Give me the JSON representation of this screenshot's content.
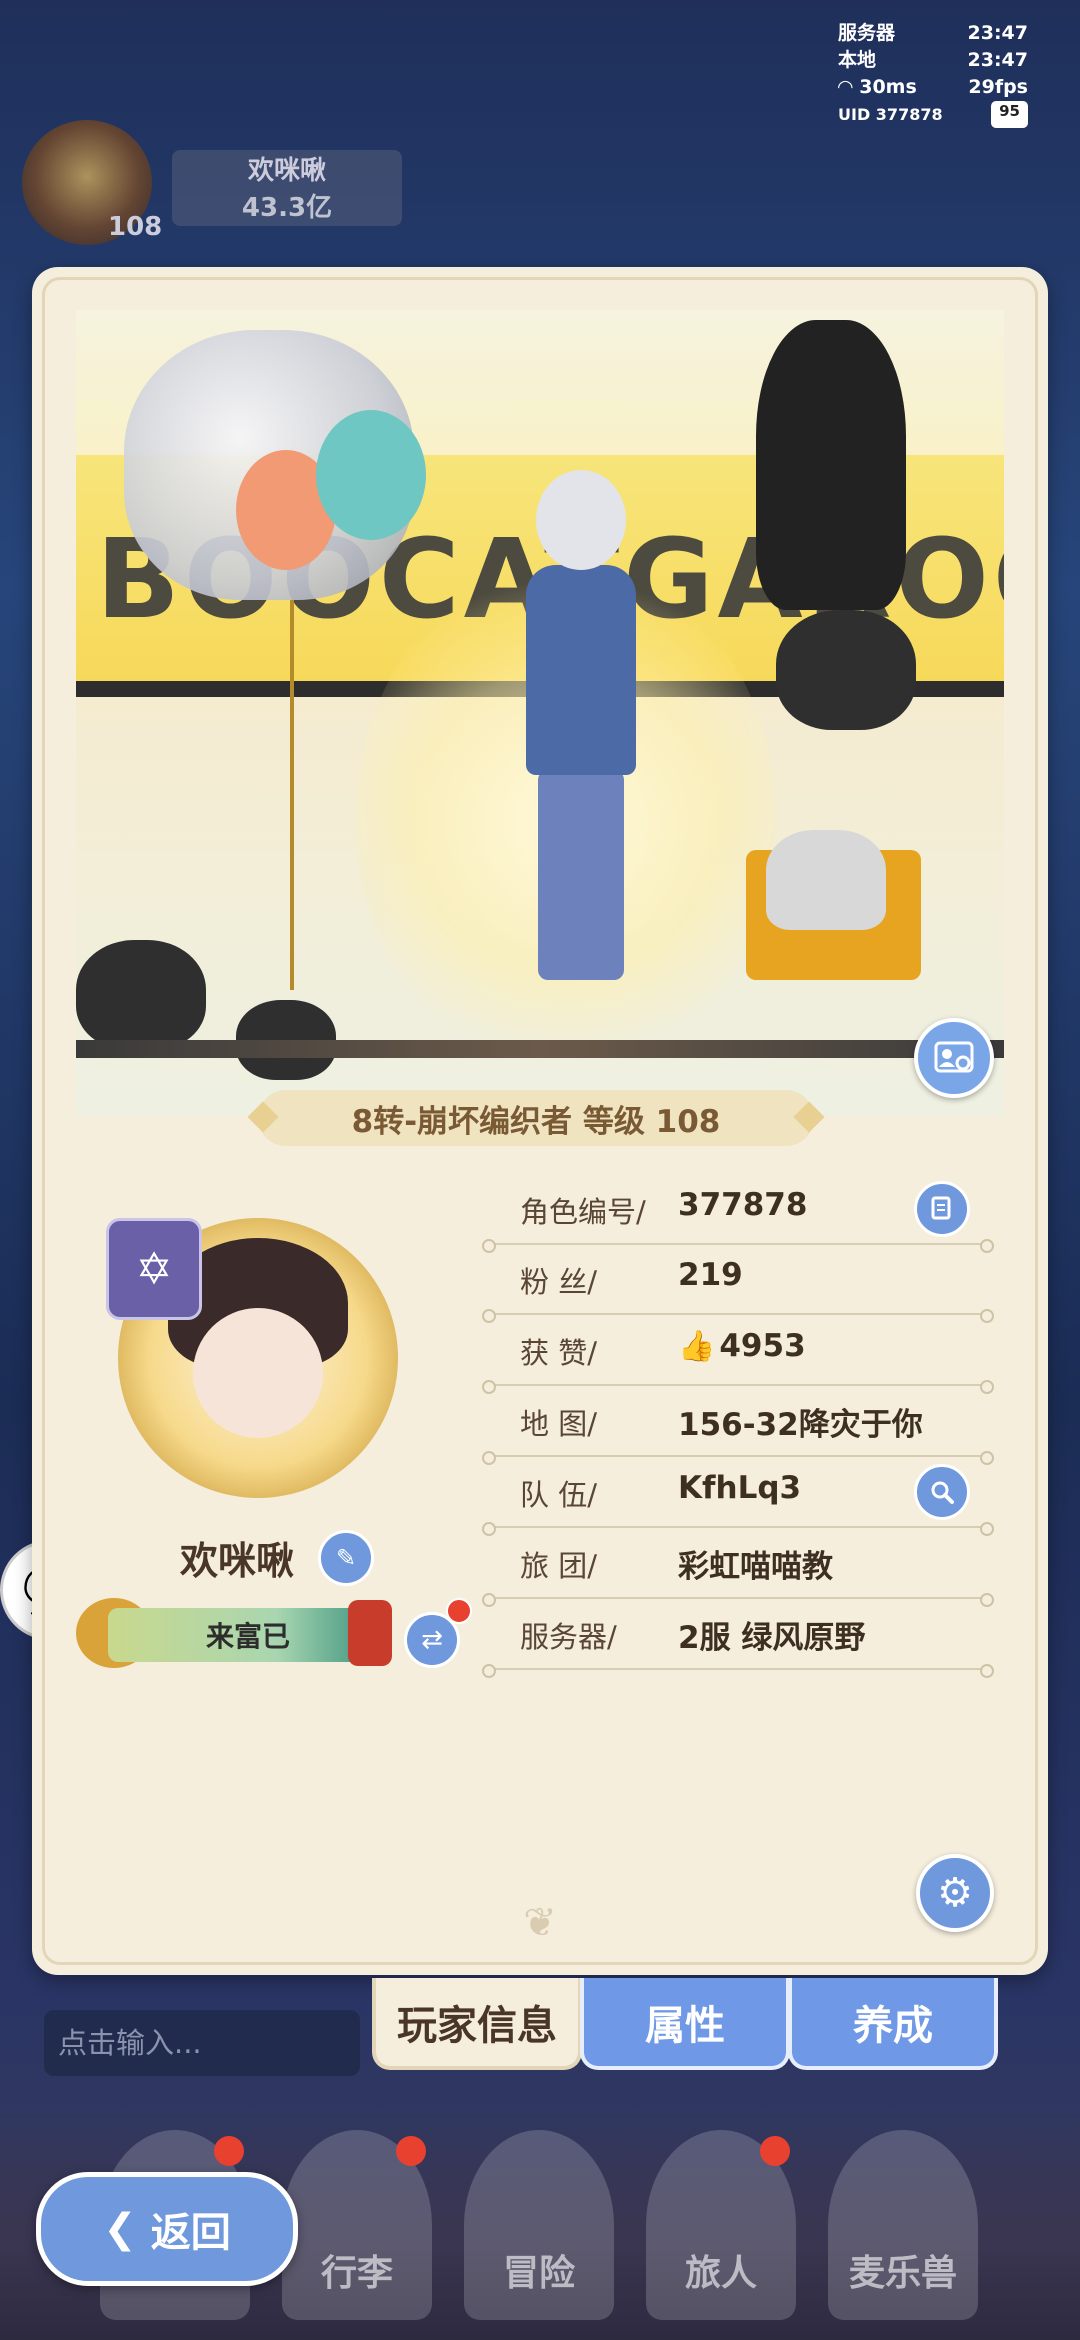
{
  "hud": {
    "server_label": "服务器",
    "server_time": "23:47",
    "local_label": "本地",
    "local_time": "23:47",
    "ping": "30ms",
    "fps": "29fps",
    "uid": "UID 377878",
    "battery": "95"
  },
  "bg_player": {
    "name": "欢咪啾",
    "power": "43.3亿",
    "level": "108"
  },
  "showcase": {
    "banner_text": "BOOCATGAROO"
  },
  "title_ribbon": "8转-崩坏编织者 等级 108",
  "profile": {
    "name": "欢咪啾",
    "nameplate": "来富已"
  },
  "info": [
    {
      "label": "角色编号/",
      "value": "377878"
    },
    {
      "label": "粉  丝/",
      "value": "219"
    },
    {
      "label": "获  赞/",
      "value": "4953"
    },
    {
      "label": "地  图/",
      "value": "156-32降灾于你"
    },
    {
      "label": "队  伍/",
      "value": "KfhLq3"
    },
    {
      "label": "旅  团/",
      "value": "彩虹喵喵教"
    },
    {
      "label": "服务器/",
      "value": "2服  绿风原野"
    }
  ],
  "tabs": {
    "info": "玩家信息",
    "attributes": "属性",
    "cultivate": "养成"
  },
  "chat": {
    "placeholder": "点击输入..."
  },
  "bottom_nav": {
    "luggage": "行李",
    "adventure": "冒险",
    "traveler": "旅人",
    "pet": "麦乐兽"
  },
  "back": "返回",
  "colors": {
    "accent_blue": "#6f98dd",
    "panel_bg": "#f5eedd",
    "notify_red": "#e8412f"
  },
  "icons": {
    "copy": "copy-icon",
    "search": "search-icon",
    "edit": "pencil-icon",
    "swap": "swap-icon",
    "settings": "gear-icon",
    "like": "thumbs-up-icon",
    "card": "profile-card-icon",
    "chat": "chat-bubble-icon",
    "back": "chevron-left-icon"
  }
}
